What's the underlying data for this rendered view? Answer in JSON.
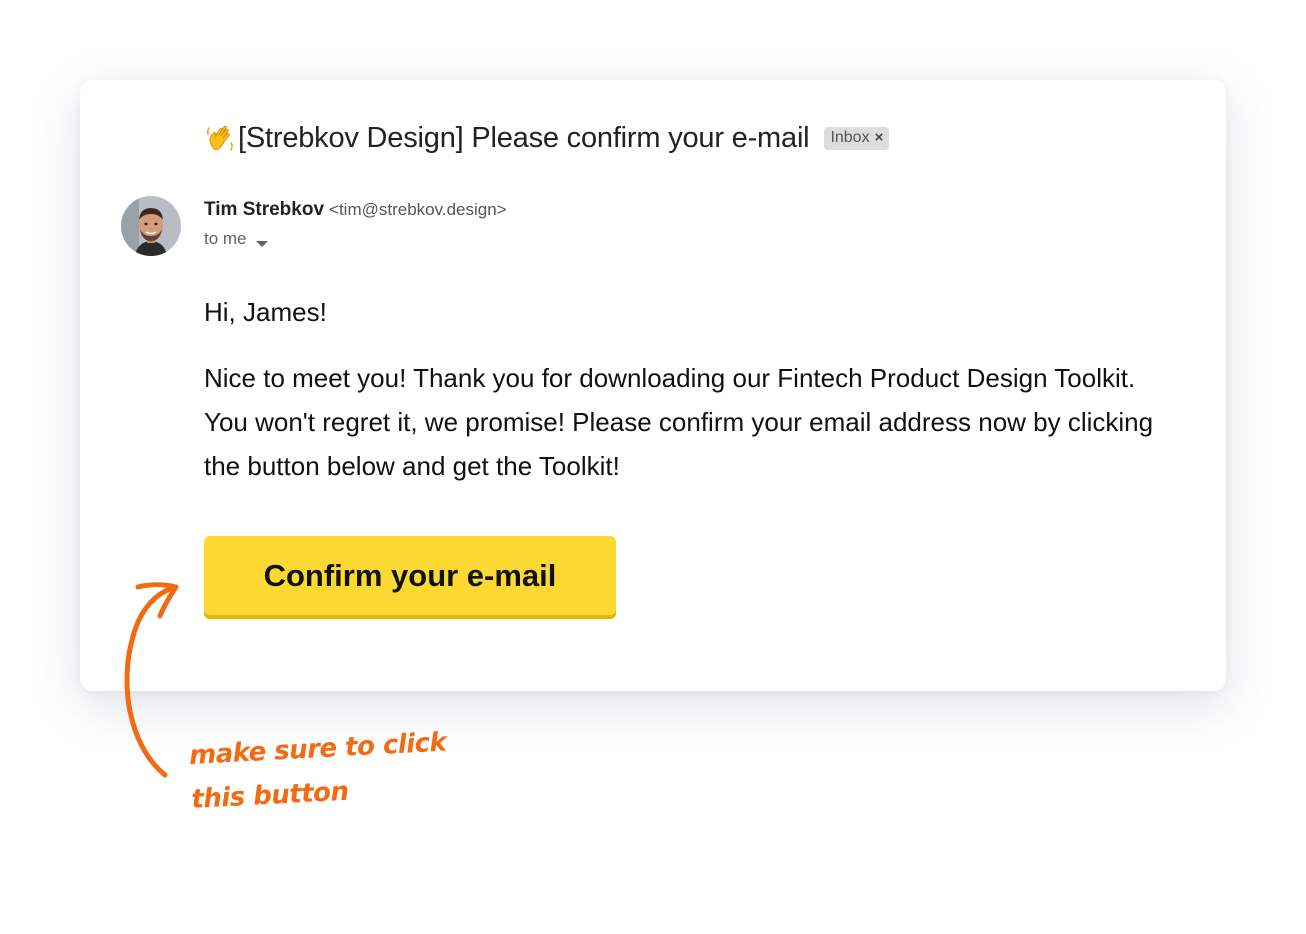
{
  "email": {
    "subject": "[Strebkov Design] Please confirm your e-mail",
    "subject_icon": "waving-hand-icon",
    "label": "Inbox",
    "label_close": "×",
    "sender": {
      "name": "Tim Strebkov",
      "email": "<tim@strebkov.design>",
      "recipient": "to me"
    },
    "greeting": "Hi, James!",
    "body": "Nice to meet you! Thank you for downloading our Fintech Product Design Toolkit. You won't regret it, we promise! Please confirm your email address now by clicking the button below and get the Toolkit!",
    "button_label": "Confirm your e-mail"
  },
  "annotation": {
    "text": "make sure to click this button"
  },
  "colors": {
    "button": "#fcd932",
    "annotation": "#f26a12",
    "label_bg": "#dddddd"
  }
}
